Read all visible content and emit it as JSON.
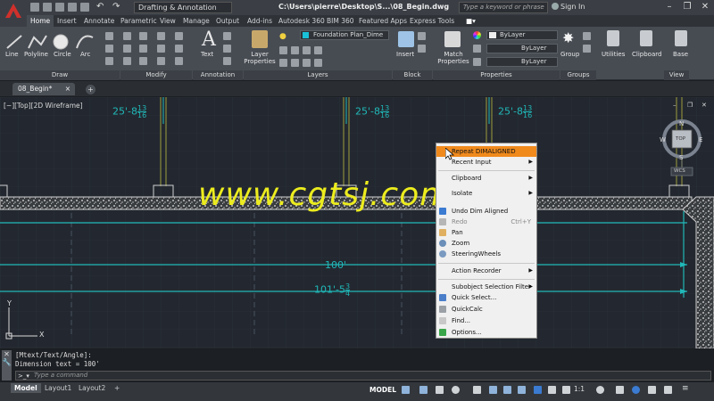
{
  "titlebar": {
    "workspace": "Drafting & Annotation",
    "document_title": "C:\\Users\\pierre\\Desktop\\S...\\08_Begin.dwg",
    "search_placeholder": "Type a keyword or phrase",
    "sign_in": "Sign In",
    "minimize": "–",
    "restore": "❐",
    "close": "✕"
  },
  "ribbon_tabs": [
    "Home",
    "Insert",
    "Annotate",
    "Parametric",
    "View",
    "Manage",
    "Output",
    "Add-ins",
    "Autodesk 360",
    "BIM 360",
    "Featured Apps",
    "Express Tools"
  ],
  "ribbon": {
    "draw_tools": [
      "Line",
      "Polyline",
      "Circle",
      "Arc"
    ],
    "text_label": "Text",
    "layer_properties_label": "Layer Properties",
    "layer_dropdown": "Foundation Plan_Dime",
    "insert_label": "Insert",
    "match_properties_label": "Match Properties",
    "bylayer_color": "ByLayer",
    "bylayer_linetype": "ByLayer",
    "bylayer_lineweight": "ByLayer",
    "group_label": "Group",
    "utilities_label": "Utilities",
    "clipboard_label": "Clipboard",
    "base_label": "Base",
    "panels": [
      "Draw",
      "Modify",
      "Annotation",
      "Layers",
      "Block",
      "Properties",
      "Groups",
      "View"
    ]
  },
  "file_tab": {
    "name": "08_Begin*",
    "close": "×",
    "new_tab": "+"
  },
  "viewport": {
    "label": "[−][Top][2D Wireframe]",
    "dimensions": {
      "top_1": {
        "main": "25'-8",
        "num": "13",
        "den": "16"
      },
      "top_2": {
        "main": "25'-8",
        "num": "13",
        "den": "16"
      },
      "top_3": {
        "main": "25'-8",
        "num": "13",
        "den": "16"
      },
      "dim_100": "100'",
      "dim_101": {
        "main": "101'-5",
        "num": "3",
        "den": "4"
      }
    },
    "viewcube": {
      "n": "N",
      "s": "S",
      "e": "E",
      "w": "W",
      "top": "TOP",
      "wcs": "WCS"
    },
    "ucs_x": "X",
    "ucs_y": "Y"
  },
  "watermark": "www.cgtsj.com",
  "context_menu": [
    {
      "label": "Repeat DIMALIGNED",
      "highlighted": true
    },
    {
      "label": "Recent Input",
      "submenu": true
    },
    {
      "label": "Clipboard",
      "submenu": true
    },
    {
      "label": "Isolate",
      "submenu": true
    },
    {
      "label": "Undo Dim Aligned"
    },
    {
      "label": "Redo",
      "shortcut": "Ctrl+Y",
      "disabled": true
    },
    {
      "label": "Pan"
    },
    {
      "label": "Zoom"
    },
    {
      "label": "SteeringWheels"
    },
    {
      "label": "Action Recorder",
      "submenu": true
    },
    {
      "label": "Subobject Selection Filter",
      "submenu": true
    },
    {
      "label": "Quick Select..."
    },
    {
      "label": "QuickCalc"
    },
    {
      "label": "Find..."
    },
    {
      "label": "Options..."
    }
  ],
  "command_line": {
    "history": [
      "[Mtext/Text/Angle]:",
      "Dimension text = 100'"
    ],
    "placeholder": "Type a command"
  },
  "status_bar": {
    "layout_tabs": [
      "Model",
      "Layout1",
      "Layout2"
    ],
    "add_tab": "+",
    "model_button": "MODEL",
    "scale": "1:1"
  },
  "colors": {
    "accent_orange": "#f08a1d",
    "dimension_cyan": "#20b8b8",
    "watermark_yellow": "#ecec1e",
    "canvas_bg": "#232830"
  }
}
